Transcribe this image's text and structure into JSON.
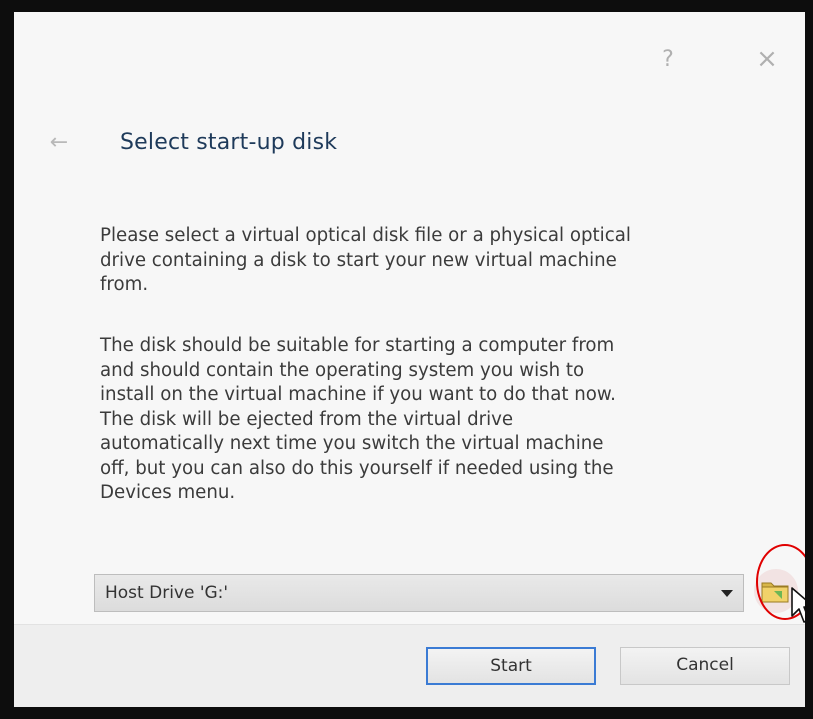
{
  "window": {
    "help_label": "?",
    "close_label": "×",
    "back_label": "←"
  },
  "page": {
    "title": "Select start-up disk",
    "paragraph1": "Please select a virtual optical disk file or a physical optical\ndrive containing a disk to start your new virtual machine\nfrom.",
    "paragraph2": "The disk should be suitable for starting a computer from\nand should contain the operating system you wish to\ninstall on the virtual machine if you want to do that now.\nThe disk will be ejected from the virtual drive\nautomatically next time you switch the virtual machine\noff, but you can also do this yourself if needed using the\nDevices menu."
  },
  "disk_select": {
    "selected_value": "Host Drive 'G:'"
  },
  "icons": {
    "folder": "folder-open-icon",
    "dropdown": "chevron-down-icon",
    "back": "arrow-left-icon"
  },
  "footer": {
    "start_label": "Start",
    "cancel_label": "Cancel"
  },
  "colors": {
    "title": "#1e3a5a",
    "focus_border": "#3b7bd4",
    "annotation_ring": "#e00000"
  }
}
